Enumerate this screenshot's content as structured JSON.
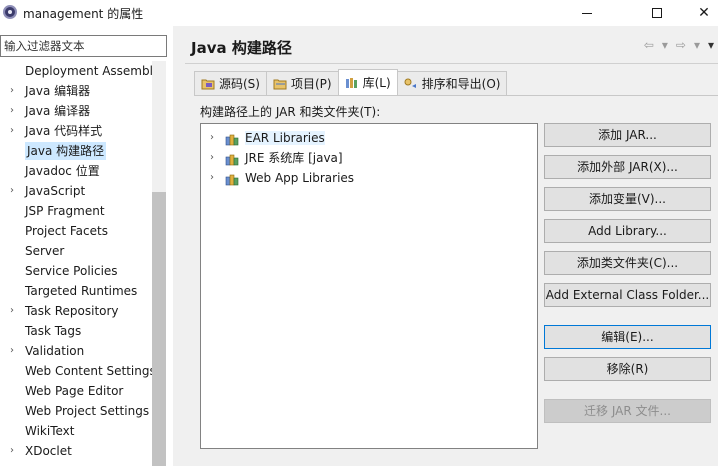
{
  "window": {
    "title": "management 的属性"
  },
  "sidebar": {
    "filter_placeholder": "输入过滤器文本",
    "items": [
      {
        "label": "Deployment Assembly",
        "expandable": false
      },
      {
        "label": "Java 编辑器",
        "expandable": true
      },
      {
        "label": "Java 编译器",
        "expandable": true
      },
      {
        "label": "Java 代码样式",
        "expandable": true
      },
      {
        "label": "Java 构建路径",
        "expandable": false,
        "selected": true
      },
      {
        "label": "Javadoc 位置",
        "expandable": false
      },
      {
        "label": "JavaScript",
        "expandable": true
      },
      {
        "label": "JSP Fragment",
        "expandable": false
      },
      {
        "label": "Project Facets",
        "expandable": false
      },
      {
        "label": "Server",
        "expandable": false
      },
      {
        "label": "Service Policies",
        "expandable": false
      },
      {
        "label": "Targeted Runtimes",
        "expandable": false
      },
      {
        "label": "Task Repository",
        "expandable": true
      },
      {
        "label": "Task Tags",
        "expandable": false
      },
      {
        "label": "Validation",
        "expandable": true
      },
      {
        "label": "Web Content Settings",
        "expandable": false
      },
      {
        "label": "Web Page Editor",
        "expandable": false
      },
      {
        "label": "Web Project Settings",
        "expandable": false
      },
      {
        "label": "WikiText",
        "expandable": false
      },
      {
        "label": "XDoclet",
        "expandable": true
      }
    ]
  },
  "main": {
    "title": "Java 构建路径",
    "tabs": [
      {
        "label": "源码(S)",
        "icon": "source-folder-icon",
        "active": false
      },
      {
        "label": "项目(P)",
        "icon": "project-icon",
        "active": false
      },
      {
        "label": "库(L)",
        "icon": "library-icon",
        "active": true
      },
      {
        "label": "排序和导出(O)",
        "icon": "order-export-icon",
        "active": false
      }
    ],
    "panel_label": "构建路径上的 JAR 和类文件夹(T):",
    "libraries": [
      {
        "label": "EAR Libraries",
        "highlight": true
      },
      {
        "label": "JRE 系统库 [java]",
        "highlight": false
      },
      {
        "label": "Web App Libraries",
        "highlight": false
      }
    ],
    "buttons": [
      {
        "label": "添加 JAR...",
        "state": "normal"
      },
      {
        "label": "添加外部 JAR(X)...",
        "state": "normal"
      },
      {
        "label": "添加变量(V)...",
        "state": "normal"
      },
      {
        "label": "Add Library...",
        "state": "normal"
      },
      {
        "label": "添加类文件夹(C)...",
        "state": "normal"
      },
      {
        "label": "Add External Class Folder...",
        "state": "normal"
      },
      {
        "label": "编辑(E)...",
        "state": "focused"
      },
      {
        "label": "移除(R)",
        "state": "normal"
      },
      {
        "label": "迁移 JAR 文件...",
        "state": "disabled"
      }
    ]
  },
  "colors": {
    "selection": "#cde8ff",
    "focus_border": "#0078d7",
    "pane_bg": "#f0f0f0"
  }
}
